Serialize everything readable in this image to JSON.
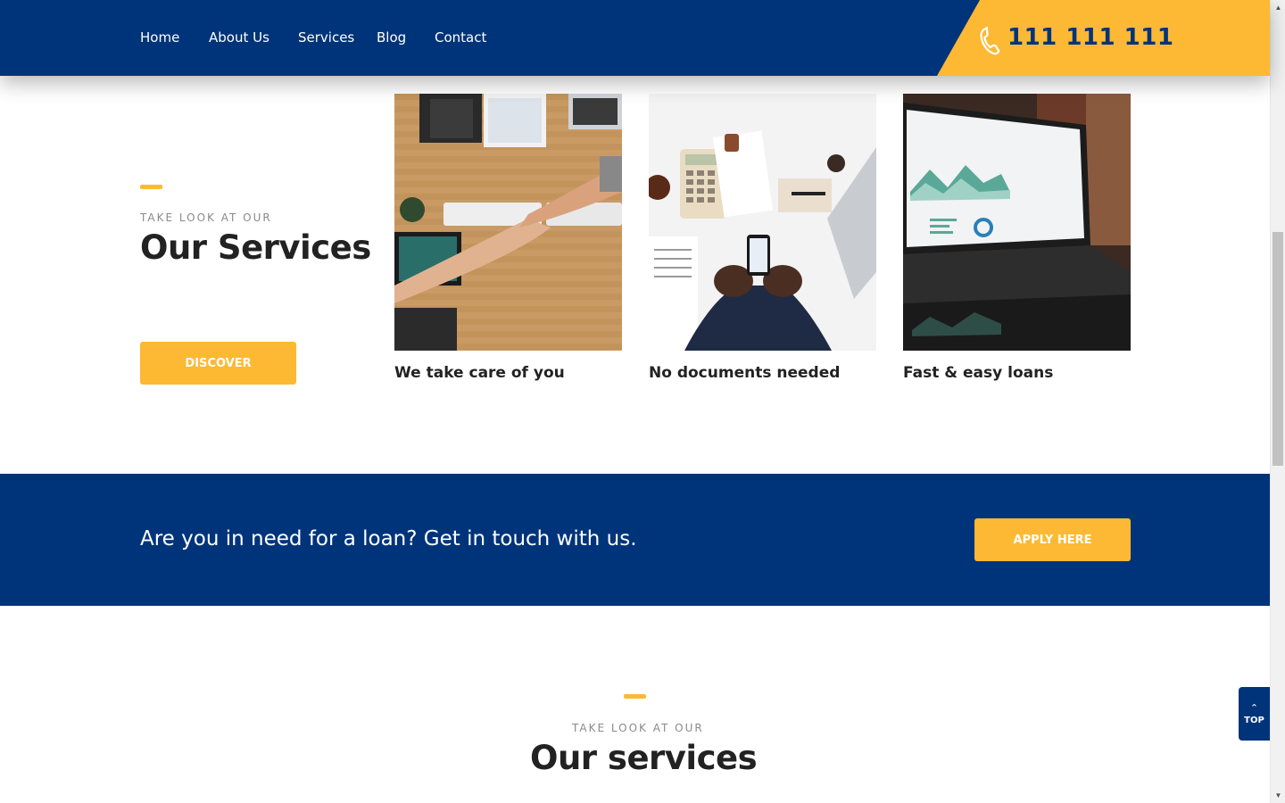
{
  "nav": {
    "items": [
      {
        "label": "Home"
      },
      {
        "label": "About Us"
      },
      {
        "label": "Services"
      },
      {
        "label": "Blog"
      },
      {
        "label": "Contact"
      }
    ],
    "phone": "111 111 111",
    "icon": "phone-icon"
  },
  "services": {
    "eyebrow": "TAKE LOOK AT OUR",
    "title": "Our Services",
    "button": "DISCOVER",
    "cards": [
      {
        "title": "We take care of you",
        "image": "handshake-photo"
      },
      {
        "title": "No documents needed",
        "image": "calculator-desk-photo"
      },
      {
        "title": "Fast & easy loans",
        "image": "laptop-chart-photo"
      }
    ]
  },
  "cta": {
    "text": "Are you in need for a loan? Get in touch with us.",
    "button": "APPLY HERE"
  },
  "services2": {
    "eyebrow": "TAKE LOOK AT OUR",
    "title": "Our services"
  },
  "top_button": {
    "label": "TOP",
    "icon": "chevron-up-icon"
  },
  "colors": {
    "navy": "#00347a",
    "accent": "#fdb933",
    "text_dark": "#222222"
  }
}
